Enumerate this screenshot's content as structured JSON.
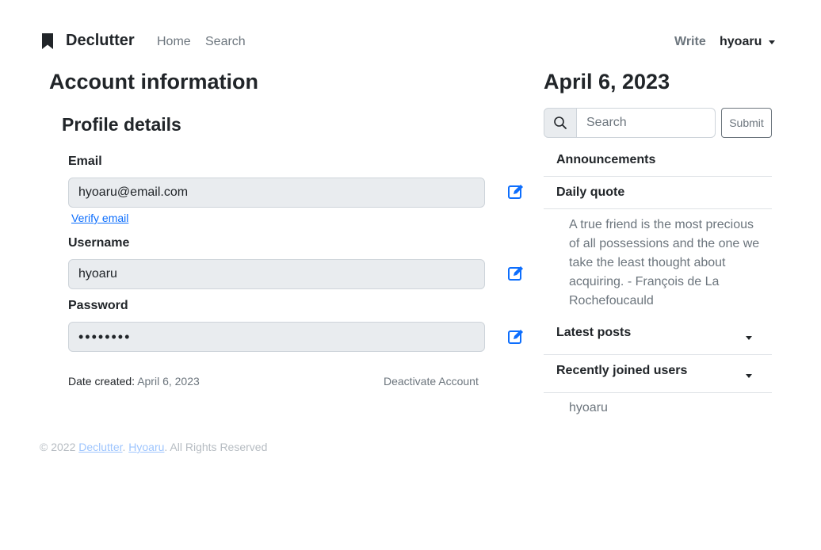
{
  "navbar": {
    "brand": "Declutter",
    "home_label": "Home",
    "search_label": "Search",
    "write_label": "Write",
    "username": "hyoaru"
  },
  "main": {
    "title": "Account information",
    "profile_title": "Profile details",
    "email_label": "Email",
    "email_value": "hyoaru@email.com",
    "verify_link": "Verify email",
    "username_label": "Username",
    "username_value": "hyoaru",
    "password_label": "Password",
    "password_value": "••••••••",
    "date_created_label": "Date created:",
    "date_created_value": "April 6, 2023",
    "deactivate_label": "Deactivate Account"
  },
  "footer": {
    "prefix": "© 2022 ",
    "link1": "Declutter",
    "sep": ". ",
    "link2": "Hyoaru",
    "suffix": ". All Rights Reserved"
  },
  "sidebar": {
    "date": "April 6, 2023",
    "search_placeholder": "Search",
    "submit_label": "Submit",
    "announcements": "Announcements",
    "daily_quote_title": "Daily quote",
    "daily_quote": "A true friend is the most precious of all possessions and the one we take the least thought about acquiring. - François de La Rochefoucauld",
    "latest_posts": "Latest posts",
    "recently_joined": "Recently joined users",
    "joined_users": [
      "hyoaru"
    ]
  },
  "colors": {
    "accent": "#0d6efd",
    "muted": "#6c757d",
    "field_bg": "#e9ecef"
  },
  "icons": {
    "brand": "bookmark-icon",
    "edit": "pencil-square-icon",
    "search": "search-icon"
  }
}
